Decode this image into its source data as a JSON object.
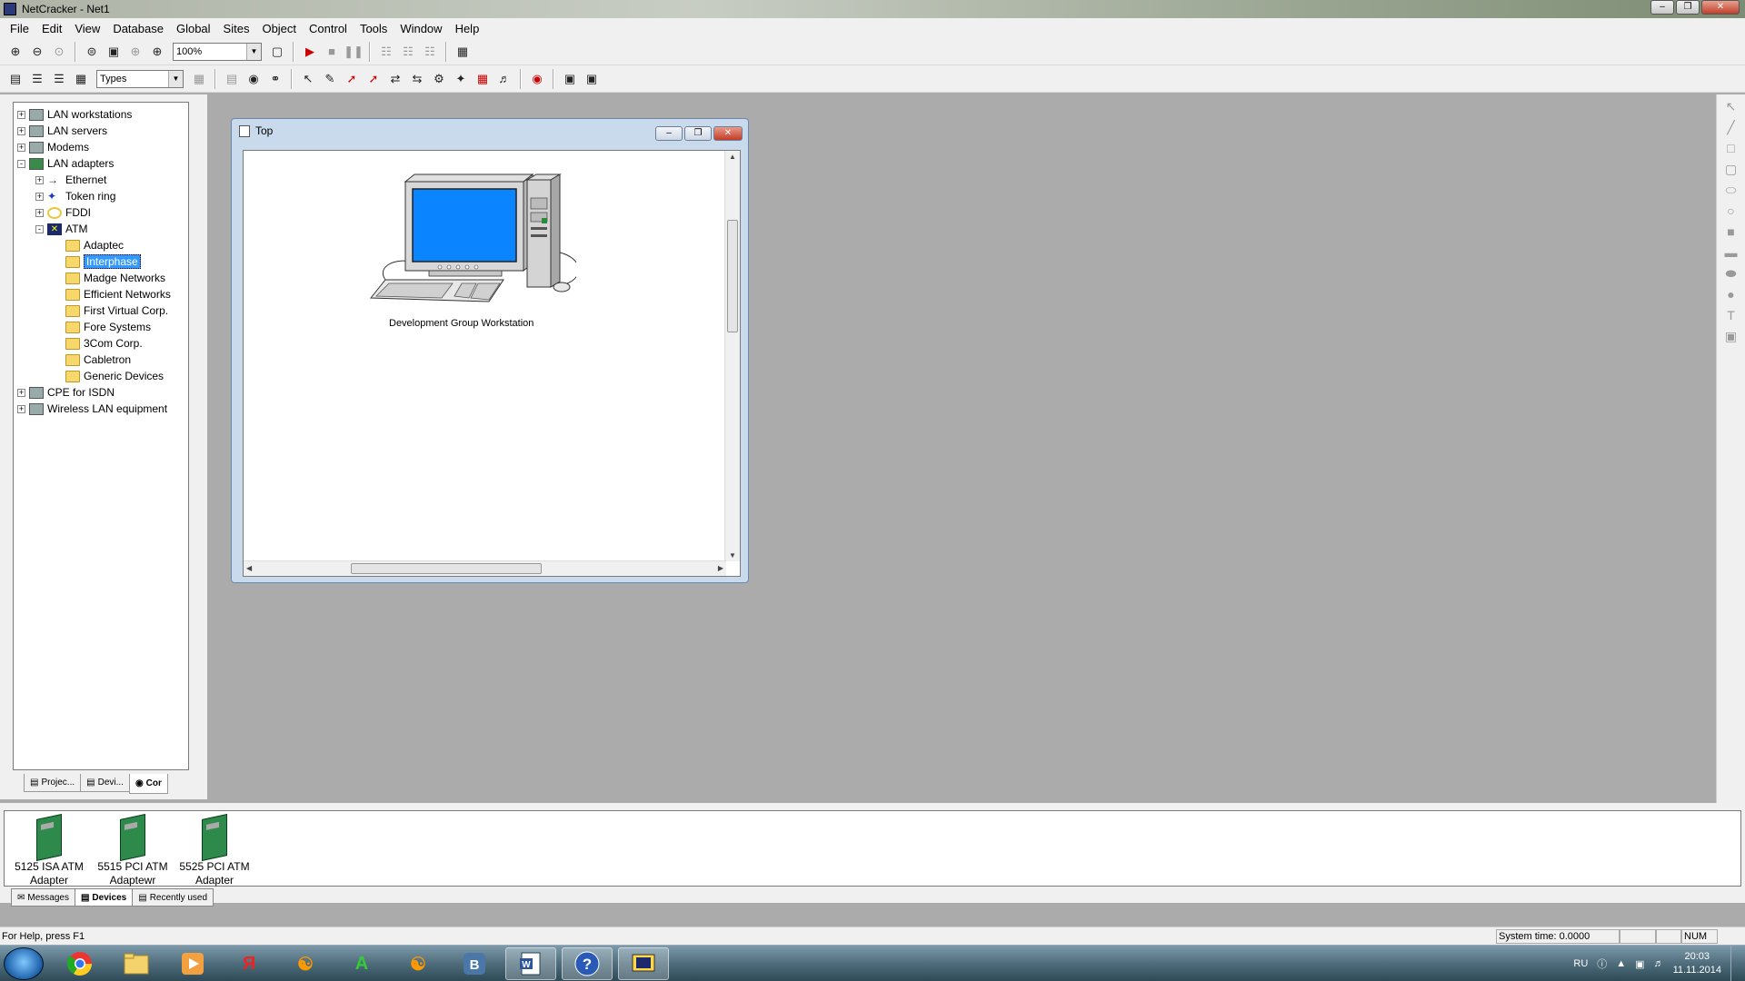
{
  "window": {
    "title": "NetCracker - Net1"
  },
  "menu": [
    "File",
    "Edit",
    "View",
    "Database",
    "Global",
    "Sites",
    "Object",
    "Control",
    "Tools",
    "Window",
    "Help"
  ],
  "toolbar": {
    "zoom_value": "100%",
    "types_value": "Types"
  },
  "tree": {
    "items": [
      {
        "label": "LAN workstations",
        "level": 0,
        "expander": "+",
        "icon": "workstation-icon"
      },
      {
        "label": "LAN servers",
        "level": 0,
        "expander": "+",
        "icon": "server-icon"
      },
      {
        "label": "Modems",
        "level": 0,
        "expander": "+",
        "icon": "modem-icon"
      },
      {
        "label": "LAN adapters",
        "level": 0,
        "expander": "-",
        "icon": "adapter-icon"
      },
      {
        "label": "Ethernet",
        "level": 1,
        "expander": "+",
        "icon": "ethernet-icon"
      },
      {
        "label": "Token ring",
        "level": 1,
        "expander": "+",
        "icon": "token-ring-icon"
      },
      {
        "label": "FDDI",
        "level": 1,
        "expander": "+",
        "icon": "fddi-icon"
      },
      {
        "label": "ATM",
        "level": 1,
        "expander": "-",
        "icon": "atm-icon"
      },
      {
        "label": "Adaptec",
        "level": 2,
        "expander": "",
        "icon": "folder-icon"
      },
      {
        "label": "Interphase",
        "level": 2,
        "expander": "",
        "icon": "folder-open-icon",
        "selected": true
      },
      {
        "label": "Madge Networks",
        "level": 2,
        "expander": "",
        "icon": "folder-icon"
      },
      {
        "label": "Efficient Networks",
        "level": 2,
        "expander": "",
        "icon": "folder-icon"
      },
      {
        "label": "First Virtual Corp.",
        "level": 2,
        "expander": "",
        "icon": "folder-icon"
      },
      {
        "label": "Fore Systems",
        "level": 2,
        "expander": "",
        "icon": "folder-icon"
      },
      {
        "label": "3Com Corp.",
        "level": 2,
        "expander": "",
        "icon": "folder-icon"
      },
      {
        "label": "Cabletron",
        "level": 2,
        "expander": "",
        "icon": "folder-icon"
      },
      {
        "label": "Generic Devices",
        "level": 2,
        "expander": "",
        "icon": "folder-icon"
      },
      {
        "label": "CPE for ISDN",
        "level": 0,
        "expander": "+",
        "icon": "isdn-icon"
      },
      {
        "label": "Wireless LAN equipment",
        "level": 0,
        "expander": "+",
        "icon": "wireless-icon"
      }
    ]
  },
  "left_tabs": [
    "Projec...",
    "Devi...",
    "Cor"
  ],
  "child_window": {
    "title": "Top",
    "device_label": "Development Group Workstation"
  },
  "devices": [
    {
      "line1": "5125 ISA ATM",
      "line2": "Adapter"
    },
    {
      "line1": "5515 PCI ATM",
      "line2": "Adaptewr"
    },
    {
      "line1": "5525 PCI ATM",
      "line2": "Adapter"
    }
  ],
  "bottom_tabs": [
    "Messages",
    "Devices",
    "Recently used"
  ],
  "status": {
    "help": "For Help, press F1",
    "system_time": "System time: 0.0000",
    "num": "NUM"
  },
  "taskbar": {
    "lang": "RU",
    "time": "20:03",
    "date": "11.11.2014"
  },
  "colors": {
    "selection": "#3399ff",
    "workspace": "#ababab",
    "monitor_screen": "#0a84ff"
  }
}
